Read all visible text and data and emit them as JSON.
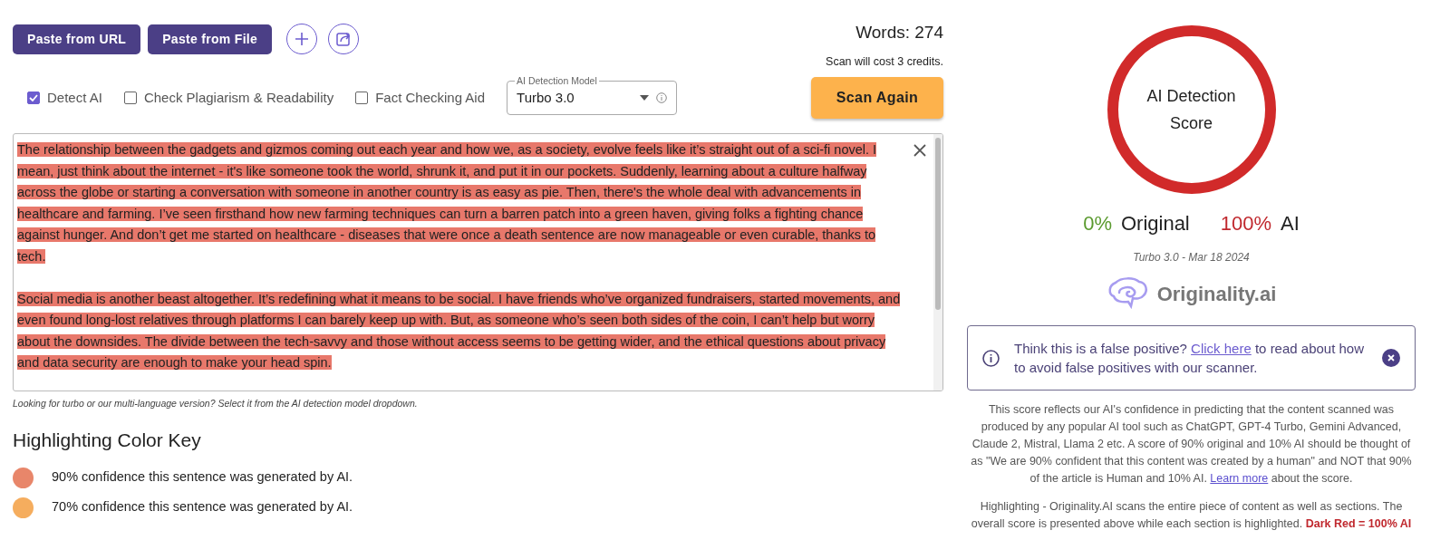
{
  "toolbar": {
    "buttons": [
      "Paste from URL",
      "Paste from File"
    ],
    "word_count": "Words: 274",
    "cost_note": "Scan will cost 3 credits."
  },
  "options": [
    {
      "label": "Detect AI",
      "checked": true
    },
    {
      "label": "Check Plagiarism & Readability",
      "checked": false
    },
    {
      "label": "Fact Checking Aid",
      "checked": false
    }
  ],
  "model_select": {
    "label": "AI Detection Model",
    "value": "Turbo 3.0"
  },
  "scan_button": "Scan Again",
  "editor": {
    "paragraphs": [
      [
        {
          "text": "The relationship between the gadgets and gizmos coming out each year and how we, as a society, evolve feels like it’s straight out of a sci-fi novel.",
          "color": "#e8786b"
        },
        {
          "text": "I mean, just think about the internet - it's like someone took the world, shrunk it, and put it in our pockets.",
          "color": "#e8786b"
        },
        {
          "text": "Suddenly, learning about a culture halfway across the globe or starting a conversation with someone in another country is as easy as pie.",
          "color": "#e8786b"
        },
        {
          "text": "Then, there's the whole deal with advancements in healthcare and farming.",
          "color": "#e8786b"
        },
        {
          "text": "I’ve seen firsthand how new farming techniques can turn a barren patch into a green haven, giving folks a fighting chance against hunger.",
          "color": "#e8786b"
        },
        {
          "text": "And don’t get me started on healthcare - diseases that were once a death sentence are now manageable or even curable, thanks to tech.",
          "color": "#e8786b"
        }
      ],
      [
        {
          "text": "Social media is another beast altogether.",
          "color": "#e8786b"
        },
        {
          "text": "It’s redefining what it means to be social.",
          "color": "#e8786b"
        },
        {
          "text": "I have friends who’ve organized fundraisers, started movements, and even found long-lost relatives through platforms I can barely keep up with.",
          "color": "#e8786b"
        },
        {
          "text": "But, as someone who’s seen both sides of the coin, I can’t help but worry about the downsides.",
          "color": "#e8786b"
        },
        {
          "text": "The divide between the tech-savvy and those without access seems to be getting wider, and the ethical questions about privacy and data security are enough to make your head spin.",
          "color": "#e8786b"
        }
      ]
    ]
  },
  "editor_hint": "Looking for turbo or our multi-language version? Select it from the AI detection model dropdown.",
  "color_key": {
    "title": "Highlighting Color Key",
    "items": [
      {
        "label": "90% confidence this sentence was generated by AI.",
        "color": "#e8866a"
      },
      {
        "label": "70% confidence this sentence was generated by AI.",
        "color": "#f5ad5e"
      }
    ]
  },
  "score": {
    "ring_label": "AI Detection Score",
    "original_percent": "0%",
    "original_label": "Original",
    "ai_percent": "100%",
    "ai_label": "AI",
    "model_date": "Turbo 3.0 - Mar 18 2024",
    "brand": "Originality.ai"
  },
  "alert": {
    "before": "Think this is a false positive?",
    "link": "Click here",
    "after": "to read about how to avoid false positives with our scanner."
  },
  "explanation": {
    "before": "This score reflects our AI's confidence in predicting that the content scanned was produced by any popular AI tool such as ChatGPT, GPT-4 Turbo, Gemini Advanced, Claude 2, Mistral, Llama 2 etc. A score of 90% original and 10% AI should be thought of as \"We are 90% confident that this content was created by a human\" and NOT that 90% of the article is Human and 10% AI.",
    "link": "Learn more",
    "after": "about the score."
  },
  "highlighting_note": {
    "text": "Highlighting - Originality.AI scans the entire piece of content as well as sections. The overall score is presented above while each section is highlighted.",
    "emphasis": "Dark Red = 100% AI"
  }
}
